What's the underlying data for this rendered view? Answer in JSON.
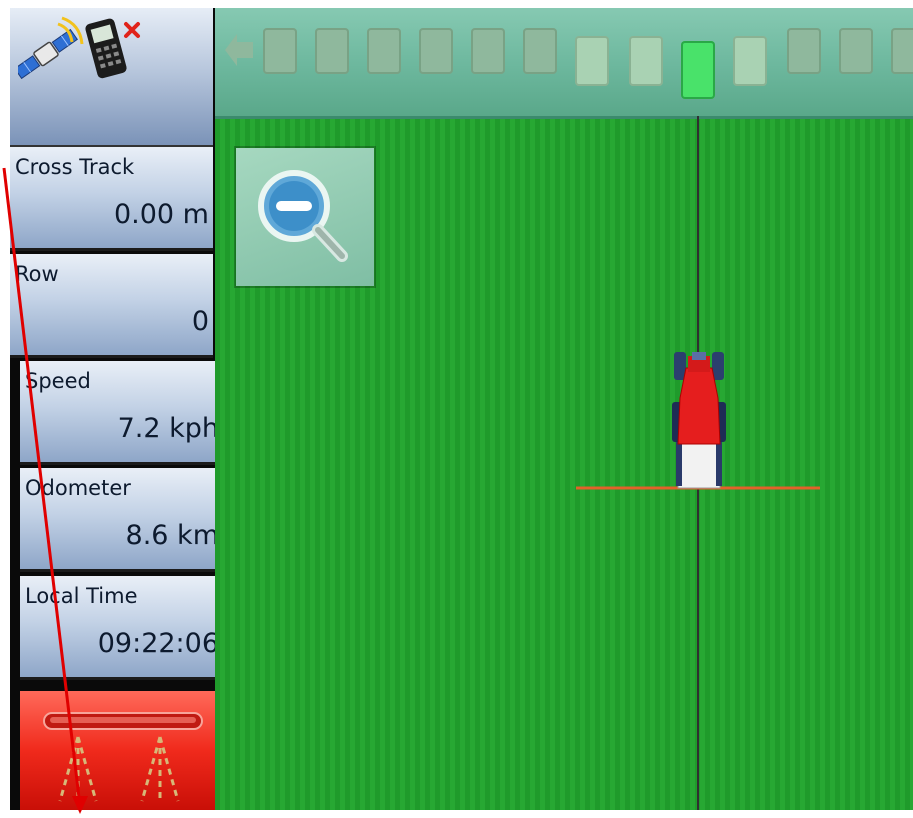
{
  "tiles": [
    {
      "label": "Cross Track",
      "value": "0.00 m"
    },
    {
      "label": "Row",
      "value": "0"
    },
    {
      "label": "Speed",
      "value": "7.2 kph"
    },
    {
      "label": "Odometer",
      "value": "8.6 km"
    },
    {
      "label": "Local Time",
      "value": "09:22:06"
    }
  ],
  "status": {
    "gps_icon": "satellite-icon",
    "modem_icon": "cellphone-disconnected-icon"
  },
  "colors": {
    "field": "#22a12f",
    "boom_off": "#e8231a",
    "active_section": "#49e26a",
    "annotation": "#e00000"
  }
}
